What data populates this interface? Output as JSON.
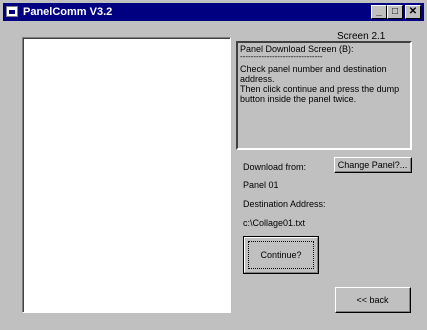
{
  "window": {
    "title": "PanelComm V3.2",
    "controls": {
      "minimize": "_",
      "maximize": "□",
      "close": "✕"
    }
  },
  "screen_label": "Screen 2.1",
  "info": {
    "heading": "Panel Download Screen (B):",
    "separator": "-------------------------------",
    "body": "Check panel number and destination address.\nThen click continue and press the dump button inside the panel twice."
  },
  "download": {
    "from_label": "Download from:",
    "change_panel_label": "Change Panel?...",
    "panel_value": "Panel 01",
    "destination_label": "Destination Address:",
    "destination_value": "c:\\Collage01.txt"
  },
  "buttons": {
    "continue": "Continue?",
    "back": "<< back"
  }
}
